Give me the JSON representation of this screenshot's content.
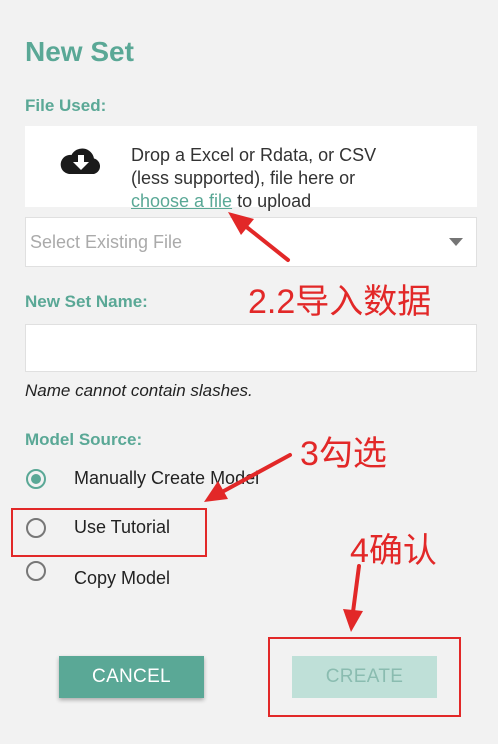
{
  "dialog": {
    "title": "New Set",
    "file_used_label": "File Used:",
    "dropzone": {
      "line1": "Drop a Excel or Rdata, or CSV",
      "line2": "(less supported), file here or",
      "link": "choose a file",
      "after_link": "to upload",
      "icon": "cloud-download-icon"
    },
    "select_file": {
      "placeholder": "Select Existing File"
    },
    "set_name_label": "New Set Name:",
    "set_name_value": "",
    "set_name_hint": "Name cannot contain slashes.",
    "model_source_label": "Model Source:",
    "model_source_options": [
      {
        "label": "Manually Create Model",
        "checked": true
      },
      {
        "label": "Use Tutorial",
        "checked": false
      },
      {
        "label": "Copy Model",
        "checked": false
      }
    ],
    "cancel_label": "CANCEL",
    "create_label": "CREATE"
  },
  "annotations": {
    "import_data": "2.2导入数据",
    "check": "3勾选",
    "confirm": "4确认",
    "color": "#e22828"
  },
  "colors": {
    "accent": "#5aa896",
    "background": "#f2f2f2",
    "create_disabled": "#bfe0d8"
  }
}
